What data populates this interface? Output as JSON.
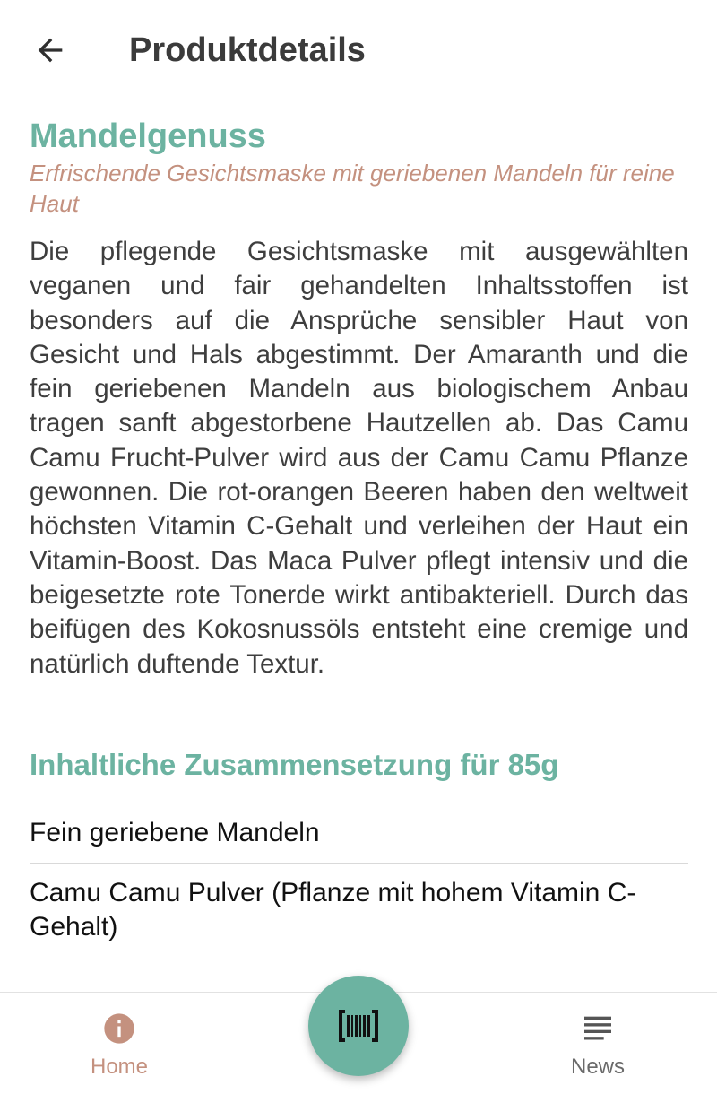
{
  "appbar": {
    "title": "Produktdetails",
    "back_icon": "arrow-left-icon"
  },
  "product": {
    "name": "Mandelgenuss",
    "subtitle": "Erfrischende Gesichtsmaske mit geriebenen Mandeln für reine Haut",
    "description": "Die pflegende Gesichtsmaske mit ausgewählten veganen und fair gehandelten Inhaltsstoffen ist besonders auf die Ansprüche sensibler Haut von Gesicht und Hals abgestimmt. Der Amaranth und die fein geriebenen Mandeln aus biologischem Anbau tragen sanft abgestorbene Hautzellen ab. Das Camu Camu Frucht-Pulver wird aus der Camu Camu Pflanze gewonnen. Die rot-orangen Beeren haben den weltweit höchsten Vitamin C-Gehalt und verleihen der Haut ein Vitamin-Boost. Das Maca Pulver pflegt intensiv und die beigesetzte rote Tonerde wirkt antibakteriell. Durch das beifügen des Kokosnussöls entsteht eine cremige und natürlich duftende Textur."
  },
  "composition": {
    "title": "Inhaltliche Zusammensetzung für 85g",
    "ingredients": [
      "Fein geriebene Mandeln",
      "Camu Camu Pulver (Pflanze mit hohem Vitamin C-Gehalt)"
    ]
  },
  "bottom_nav": {
    "home_label": "Home",
    "home_icon": "info-circle-icon",
    "news_label": "News",
    "news_icon": "news-lines-icon",
    "fab_icon": "barcode-scan-icon"
  },
  "colors": {
    "accent": "#6cb3a1",
    "secondary": "#c4917f",
    "text": "#3e3e3e"
  }
}
